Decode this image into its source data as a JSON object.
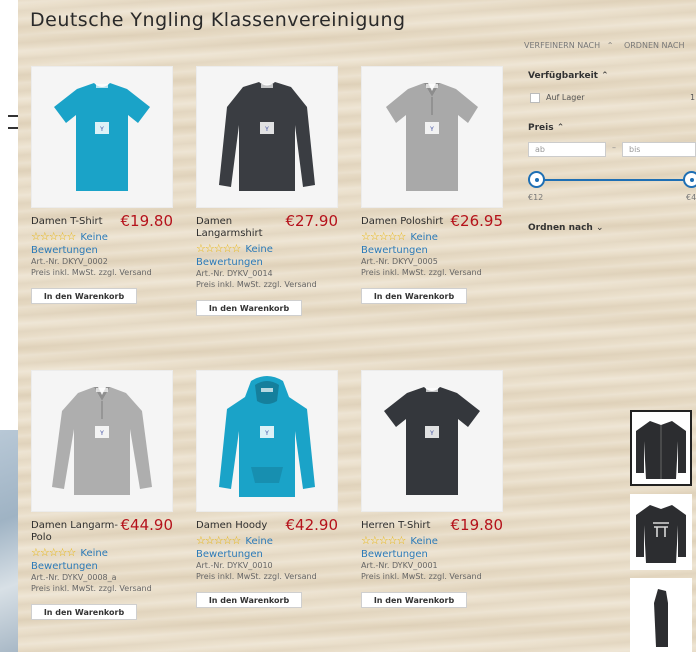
{
  "page": {
    "title": "Deutsche Yngling Klassenvereinigung"
  },
  "colors": {
    "price": "#b5121b",
    "link": "#2b7ab8",
    "accent": "#1e6fb4",
    "star": "#e8b300"
  },
  "filters": {
    "refine_label": "VERFEINERN NACH",
    "sort_top_label": "ORDNEN NACH",
    "availability_label": "Verfügbarkeit",
    "in_stock_label": "Auf Lager",
    "in_stock_count": "1",
    "price_label": "Preis",
    "price_from_placeholder": "ab",
    "price_dash": "–",
    "price_to_placeholder": "bis",
    "price_min": "€12",
    "price_max": "€4",
    "sort_label": "Ordnen nach"
  },
  "cart_label": "In den Warenkorb",
  "products": [
    {
      "name": "Damen T-Shirt",
      "price": "€19.80",
      "stars": "☆☆☆☆☆",
      "review_inline": "Keine",
      "review_line": "Bewertungen",
      "sku": "Art.-Nr. DKYV_0002",
      "tax_note": "Preis inkl. MwSt. zzgl. Versand",
      "garment": "tshirt",
      "color": "#1aa3c8"
    },
    {
      "name": "Damen Langarmshirt",
      "price": "€27.90",
      "stars": "☆☆☆☆☆",
      "review_inline": "Keine",
      "review_line": "Bewertungen",
      "sku": "Art.-Nr. DYKV_0014",
      "tax_note": "Preis inkl. MwSt. zzgl. Versand",
      "garment": "longsleeve",
      "color": "#3a3d42"
    },
    {
      "name": "Damen Poloshirt",
      "price": "€26.95",
      "stars": "☆☆☆☆☆",
      "review_inline": "Keine",
      "review_line": "Bewertungen",
      "sku": "Art.-Nr. DKYV_0005",
      "tax_note": "Preis inkl. MwSt. zzgl. Versand",
      "garment": "polo",
      "color": "#a9a9a9"
    },
    {
      "name": "Damen Langarm-Polo",
      "price": "€44.90",
      "stars": "☆☆☆☆☆",
      "review_inline": "Keine",
      "review_line": "Bewertungen",
      "sku": "Art.-Nr. DYKV_0008_a",
      "tax_note": "Preis inkl. MwSt. zzgl. Versand",
      "garment": "longpolo",
      "color": "#aeaeae"
    },
    {
      "name": "Damen Hoody",
      "price": "€42.90",
      "stars": "☆☆☆☆☆",
      "review_inline": "Keine",
      "review_line": "Bewertungen",
      "sku": "Art.-Nr. DYKV_0010",
      "tax_note": "Preis inkl. MwSt. zzgl. Versand",
      "garment": "hoody",
      "color": "#1aa3c8"
    },
    {
      "name": "Herren T-Shirt",
      "price": "€19.80",
      "stars": "☆☆☆☆☆",
      "review_inline": "Keine",
      "review_line": "Bewertungen",
      "sku": "Art.-Nr. DYKV_0001",
      "tax_note": "Preis inkl. MwSt. zzgl. Versand",
      "garment": "tshirt",
      "color": "#34373c"
    }
  ],
  "thumbnails": [
    {
      "selected": true
    },
    {
      "selected": false
    },
    {
      "selected": false
    }
  ]
}
